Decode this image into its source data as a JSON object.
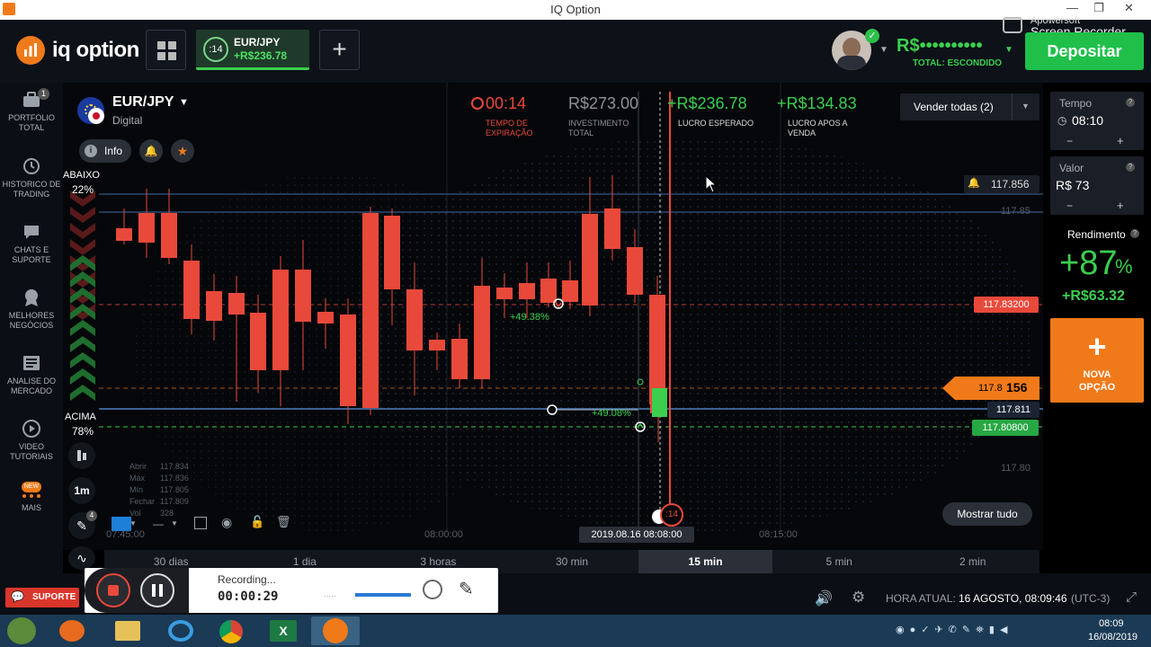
{
  "window": {
    "title": "IQ Option"
  },
  "header": {
    "logo_text": "iq option",
    "asset_tab": {
      "timer": ":14",
      "pair": "EUR/JPY",
      "profit": "+R$236.78"
    },
    "balance": "R$••••••••••",
    "balance_sub": "TOTAL: ESCONDIDO",
    "deposit_label": "Depositar",
    "recorder_watermark_top": "Apowersoft",
    "recorder_watermark": "Screen Recorder"
  },
  "sidebar": {
    "items": [
      {
        "label_1": "PORTFOLIO",
        "label_2": "TOTAL",
        "badge": "1"
      },
      {
        "label_1": "HISTORICO DE",
        "label_2": "TRADING"
      },
      {
        "label_1": "CHATS E",
        "label_2": "SUPORTE"
      },
      {
        "label_1": "MELHORES",
        "label_2": "NEGÓCIOS"
      },
      {
        "label_1": "ANALISE DO",
        "label_2": "MERCADO"
      },
      {
        "label_1": "VIDEO",
        "label_2": "TUTORIAIS"
      },
      {
        "label_1": "MAIS",
        "label_2": "",
        "badge": "NEW"
      }
    ]
  },
  "asset": {
    "name": "EUR/JPY",
    "type": "Digital",
    "info_label": "Info"
  },
  "stats": {
    "expiry_value": "00:14",
    "expiry_label_1": "TEMPO DE",
    "expiry_label_2": "EXPIRAÇÃO",
    "investment_value": "R$273.00",
    "investment_label_1": "INVESTIMENTO",
    "investment_label_2": "TOTAL",
    "expected_value": "+R$236.78",
    "expected_label": "LUCRO ESPERADO",
    "after_sale_value": "+R$134.83",
    "after_sale_label_1": "LUCRO APOS A",
    "after_sale_label_2": "VENDA",
    "sell_all_label": "Vender todas (2)"
  },
  "sentiment": {
    "down_label": "ABAIXO",
    "down_pct": "22%",
    "up_label": "ACIMA",
    "up_pct": "78%"
  },
  "price_tags": {
    "alert": "117.856",
    "grid_1": "117.85",
    "red_level": "117.83200",
    "current_prefix": "117.8",
    "current_suffix": "156",
    "blue_level": "117.811",
    "green_level": "117.80800",
    "grid_2": "117.80"
  },
  "trade_labels": {
    "upper": "+49.38%",
    "lower": "+49.08%",
    "timer_bubble": ":14"
  },
  "ohlc": {
    "open_label": "Abrir",
    "open": "117.834",
    "max_label": "Máx",
    "max": "117.836",
    "min_label": "Mín",
    "min": "117.805",
    "close_label": "Fechar",
    "close": "117.809",
    "vol_label": "Vol",
    "vol": "328"
  },
  "time_axis": {
    "t1": "07:45:00",
    "t2": "08:00:00",
    "current": "2019.08.16 08:08:00",
    "t3": "08:15:00"
  },
  "show_all_label": "Mostrar tudo",
  "chart_tools": {
    "interval": "1m",
    "pen_badge": "4"
  },
  "right_panel": {
    "time_label": "Tempo",
    "time_value": "08:10",
    "value_label": "Valor",
    "value_value": "R$ 73",
    "yield_label": "Rendimento",
    "yield_value": "+87",
    "yield_pct": "%",
    "yield_amount": "+R$63.32",
    "new_option_1": "NOVA",
    "new_option_2": "OPÇÃO",
    "minus": "−",
    "plus": "+"
  },
  "timeframes": [
    "30 dias",
    "1 dia",
    "3 horas",
    "30 min",
    "15 min",
    "5 min",
    "2 min"
  ],
  "timeframe_active": "15 min",
  "footer": {
    "support": "SUPORTE",
    "recording_label": "Recording...",
    "recording_time": "00:00:29",
    "server_time_label": "HORA ATUAL:",
    "server_time_value": "16 AGOSTO, 08:09:46",
    "timezone": "(UTC-3)"
  },
  "taskbar": {
    "clock_time": "08:09",
    "clock_date": "16/08/2019"
  },
  "colors": {
    "green": "#3ccf4e",
    "red": "#e8493a",
    "orange": "#f07a1a",
    "bg": "#05070a"
  }
}
